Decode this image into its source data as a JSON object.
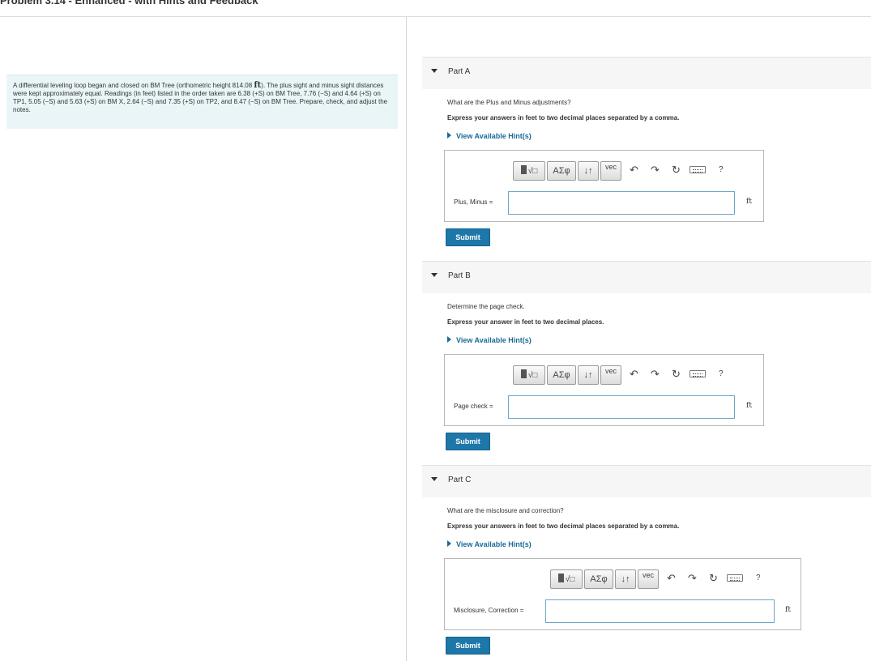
{
  "header": {
    "title": "Problem 3.14 - Enhanced - with Hints and Feedback"
  },
  "problem": {
    "text_before_unit": "A differential leveling loop began and closed on BM Tree (orthometric height 814.08 ",
    "unit": "ft",
    "text_after_unit": "). The plus sight and minus sight distances were kept approximately equal. Readings (in feet) listed in the order taken are 6.38 (+S) on BM Tree, 7.76 (−S) and 4.64 (+S) on TP1, 5.05 (−S) and 5.63 (+S) on BM X, 2.64 (−S) and 7.35 (+S) on TP2, and 8.47 (−S) on BM Tree. Prepare, check, and adjust the notes."
  },
  "toolbar": {
    "templates_icon": "fraction-sqrt-template-icon",
    "greek_label": "ΑΣφ",
    "arrows_label": "↓↑",
    "vec_label": "vec",
    "undo_icon": "undo-icon",
    "redo_icon": "redo-icon",
    "reset_icon": "reset-icon",
    "keyboard_icon": "keyboard-icon",
    "help_label": "?"
  },
  "parts": [
    {
      "title": "Part A",
      "question": "What are the Plus and Minus adjustments?",
      "instruction": "Express your answers in feet to two decimal places separated by a comma.",
      "hint": "View Available Hint(s)",
      "answer_label": "Plus, Minus =",
      "answer_value": "",
      "unit": "ft",
      "submit": "Submit"
    },
    {
      "title": "Part B",
      "question": "Determine the page check.",
      "instruction": "Express your answer in feet to two decimal places.",
      "hint": "View Available Hint(s)",
      "answer_label": "Page check =",
      "answer_value": "",
      "unit": "ft",
      "submit": "Submit"
    },
    {
      "title": "Part C",
      "question": "What are the misclosure and correction?",
      "instruction": "Express your answers in feet to two decimal places separated by a comma.",
      "hint": "View Available Hint(s)",
      "answer_label": "Misclosure, Correction =",
      "answer_value": "",
      "unit": "ft",
      "submit": "Submit"
    }
  ]
}
